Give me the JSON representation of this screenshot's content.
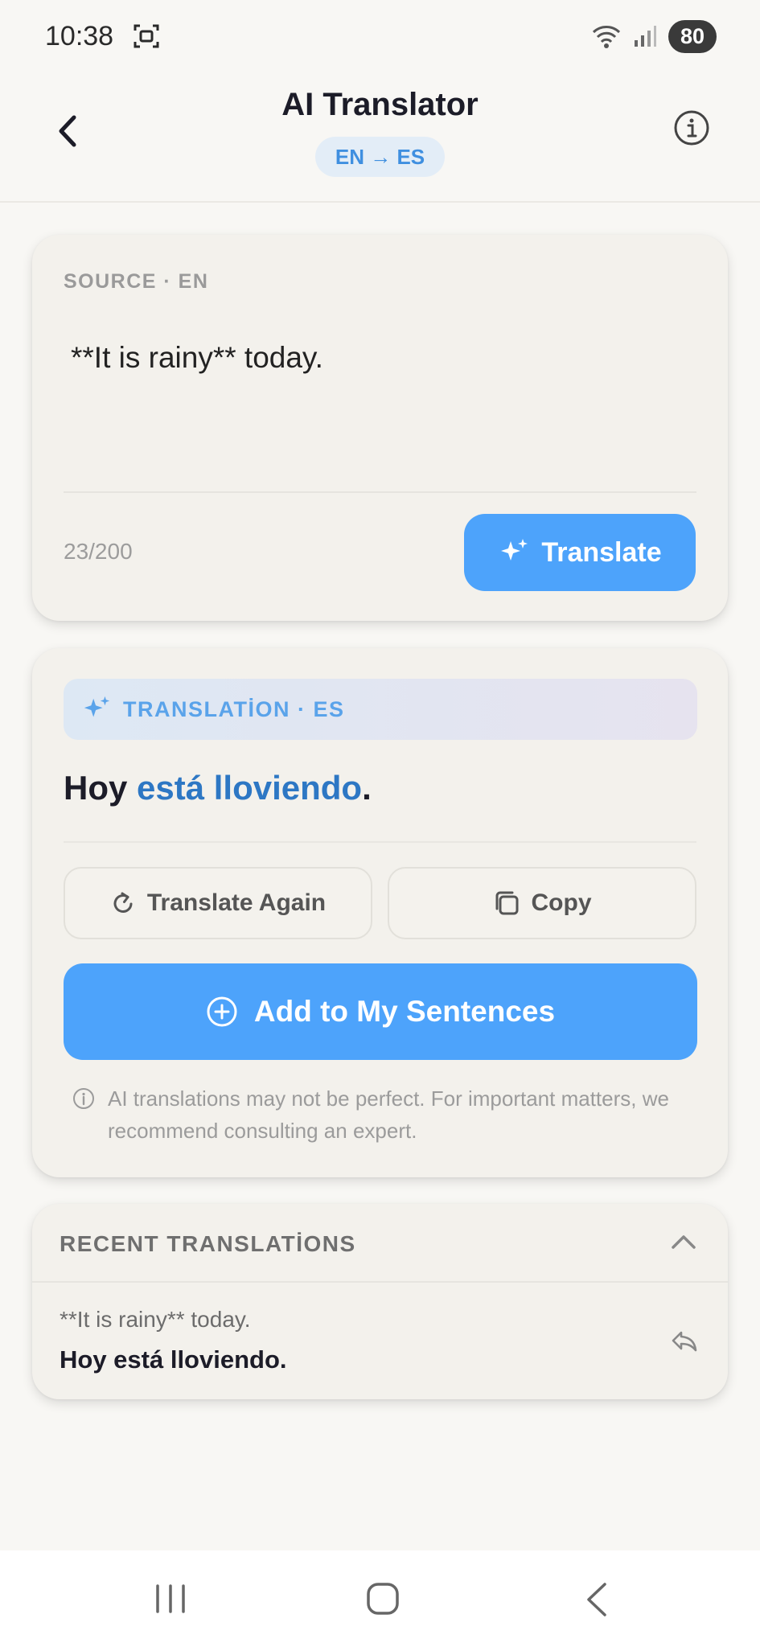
{
  "status_bar": {
    "time": "10:38",
    "battery": "80"
  },
  "header": {
    "title": "AI Translator",
    "lang_pair": "EN → ES"
  },
  "source": {
    "label": "SOURCE · EN",
    "text": "**It is rainy** today.",
    "char_count": "23/200",
    "translate_label": "Translate"
  },
  "result": {
    "label": "TRANSLATİON · ES",
    "text_before": "Hoy ",
    "text_highlight": "está lloviendo",
    "text_after": ".",
    "translate_again_label": "Translate Again",
    "copy_label": "Copy",
    "add_label": "Add to My Sentences",
    "disclaimer": "AI translations may not be perfect. For important matters, we recommend consulting an expert."
  },
  "recent": {
    "title": "RECENT TRANSLATİONS",
    "items": [
      {
        "source": "**It is rainy** today.",
        "target": "Hoy está lloviendo."
      }
    ]
  },
  "colors": {
    "accent": "#4da3fb",
    "highlight": "#2d77c4"
  }
}
